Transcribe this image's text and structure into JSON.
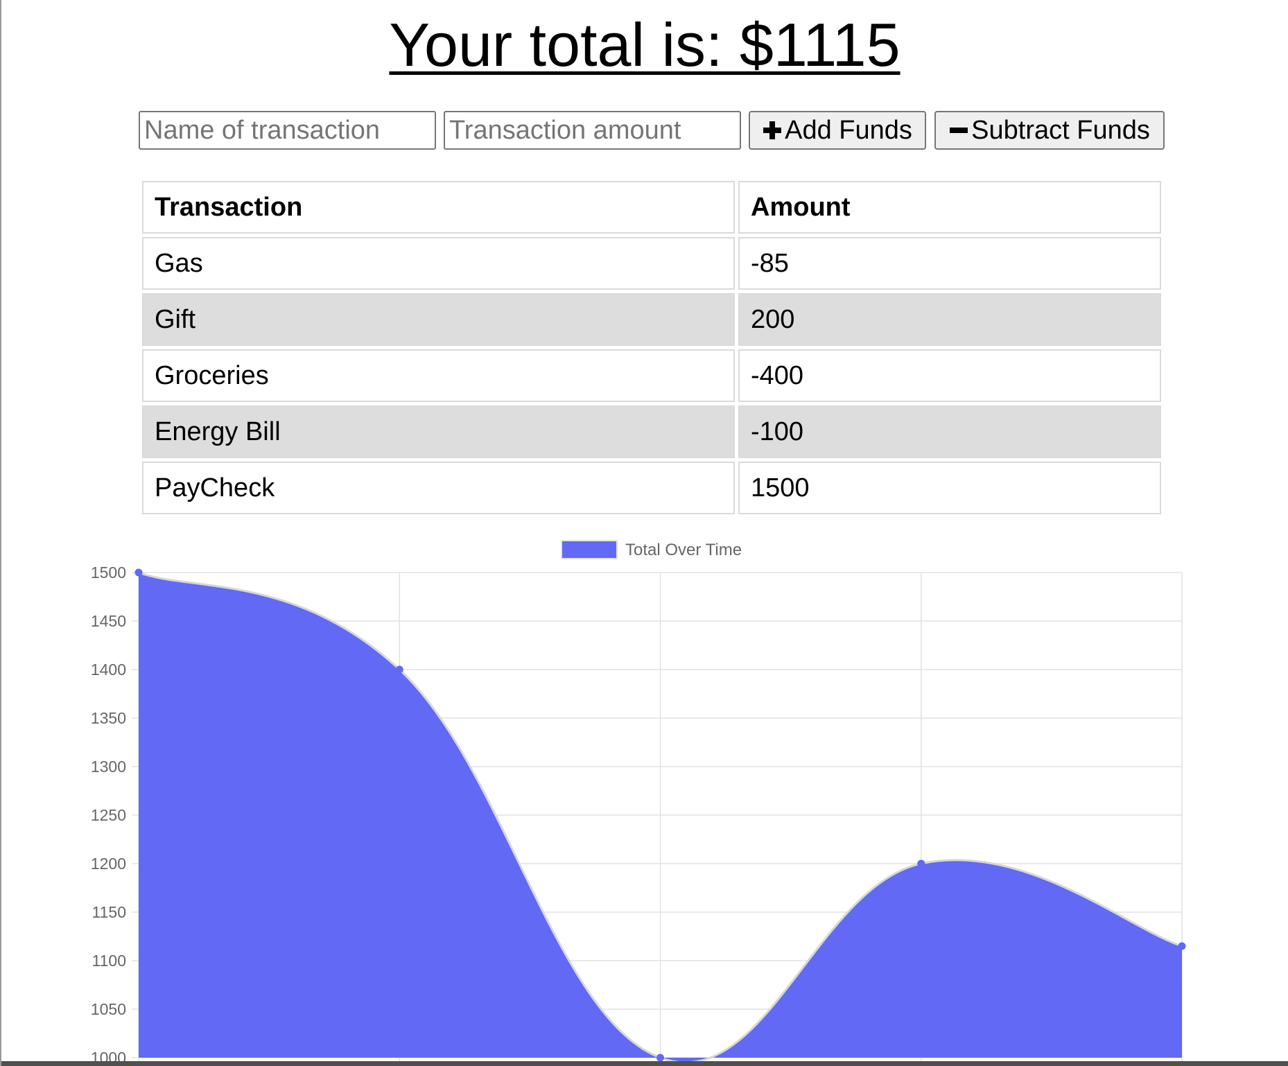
{
  "header": {
    "title": "Your total is: $1115"
  },
  "form": {
    "name_placeholder": "Name of transaction",
    "amount_placeholder": "Transaction amount",
    "add_label": "Add Funds",
    "subtract_label": "Subtract Funds"
  },
  "table": {
    "headers": [
      "Transaction",
      "Amount"
    ],
    "rows": [
      {
        "name": "Gas",
        "amount": "-85"
      },
      {
        "name": "Gift",
        "amount": "200"
      },
      {
        "name": "Groceries",
        "amount": "-400"
      },
      {
        "name": "Energy Bill",
        "amount": "-100"
      },
      {
        "name": "PayCheck",
        "amount": "1500"
      }
    ]
  },
  "colors": {
    "fill": "#6169f5",
    "line": "#d6d6d6",
    "grid": "#e2e2e2",
    "tick_text": "#666666"
  },
  "chart_data": {
    "type": "area",
    "series": [
      {
        "name": "Total Over Time",
        "values": [
          1500,
          1400,
          1000,
          1200,
          1115
        ]
      }
    ],
    "x": [
      "",
      "",
      "",
      "",
      ""
    ],
    "ylim": [
      1000,
      1500
    ],
    "yticks": [
      "1500",
      "1450",
      "1400",
      "1350",
      "1300",
      "1250",
      "1200",
      "1150",
      "1100",
      "1050",
      "1000"
    ],
    "legend_position": "top",
    "grid": true,
    "curve": "smooth"
  }
}
